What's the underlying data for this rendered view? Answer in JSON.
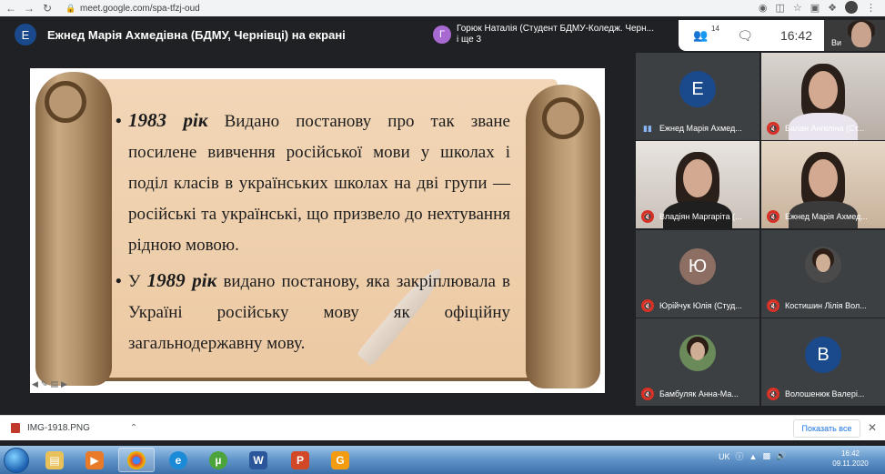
{
  "browser": {
    "url": "meet.google.com/spa-tfzj-oud"
  },
  "meet": {
    "presenter_initial": "Е",
    "presenter_title": "Ежнед Марія Ахмедівна (БДМУ, Чернівці) на екрані",
    "notification_initial": "Г",
    "notification_line1": "Горюк Наталія (Студент БДМУ-Коледж. Черн...",
    "notification_line2": "і ще 3",
    "people_count": "14",
    "time": "16:42",
    "self_label": "Ви"
  },
  "slide": {
    "para1_year": "1983 рік",
    "para1_text": " Видано постанову про так зване посилене вивчення російської мови у школах і поділ класів в українських школах на дві групи — російські та українські, що призвело до нехтування рідною мовою.",
    "para2_prefix": "У ",
    "para2_year": "1989 рік",
    "para2_text": " видано постанову, яка закріплювала в Україні російську мову як офіційну загальнодержавну мову."
  },
  "participants": [
    {
      "name": "Ежнед Марія Ахмед...",
      "initial": "Е",
      "type": "avatar",
      "color": "#1a4a8c",
      "mic": "on"
    },
    {
      "name": "Балан Ангеліна (Ст...",
      "type": "video",
      "mic": "off"
    },
    {
      "name": "Владіян Маргаріта (...",
      "type": "video",
      "mic": "off"
    },
    {
      "name": "Ежнед Марія Ахмед...",
      "type": "video",
      "mic": "off"
    },
    {
      "name": "Юрійчук Юлія (Студ...",
      "initial": "Ю",
      "type": "avatar",
      "color": "#8d6e63",
      "mic": "off"
    },
    {
      "name": "Костишин Лілія Вол...",
      "type": "photo",
      "mic": "off"
    },
    {
      "name": "Бамбуляк Анна-Ма...",
      "type": "photo",
      "mic": "off"
    },
    {
      "name": "Волошенюк Валері...",
      "initial": "В",
      "type": "avatar",
      "color": "#1a4a8c",
      "mic": "off"
    }
  ],
  "downloads": {
    "file_name": "IMG-1918.PNG",
    "show_all": "Показать все"
  },
  "taskbar": {
    "lang": "UK",
    "time": "16:42",
    "date": "09.11.2020"
  }
}
